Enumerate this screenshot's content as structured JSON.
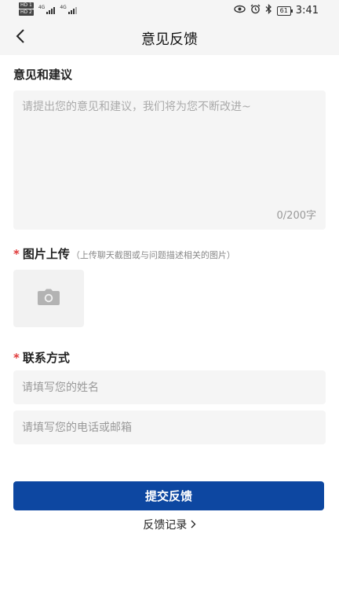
{
  "status_bar": {
    "sim1_tag": "HD 1",
    "sim2_tag": "HD 2",
    "net1": "4G",
    "net2": "4G",
    "battery_level": "61",
    "time": "3:41",
    "icons": [
      "eye-icon",
      "alarm-icon",
      "bluetooth-icon",
      "battery-icon"
    ]
  },
  "header": {
    "title": "意见反馈",
    "back_icon": "chevron-left-icon"
  },
  "suggestion": {
    "title": "意见和建议",
    "placeholder": "请提出您的意见和建议，我们将为您不断改进~",
    "value": "",
    "counter": "0/200字"
  },
  "image_upload": {
    "required_mark": "*",
    "title": "图片上传",
    "hint": "（上传聊天截图或与问题描述相关的图片）",
    "icon": "camera-icon"
  },
  "contact": {
    "required_mark": "*",
    "title": "联系方式",
    "name_placeholder": "请填写您的姓名",
    "phone_placeholder": "请填写您的电话或邮箱"
  },
  "actions": {
    "submit_label": "提交反馈",
    "history_label": "反馈记录",
    "history_icon": "chevron-right-icon"
  },
  "colors": {
    "primary": "#0d47a1",
    "required": "#e03c3c",
    "field_bg": "#f5f5f5"
  }
}
